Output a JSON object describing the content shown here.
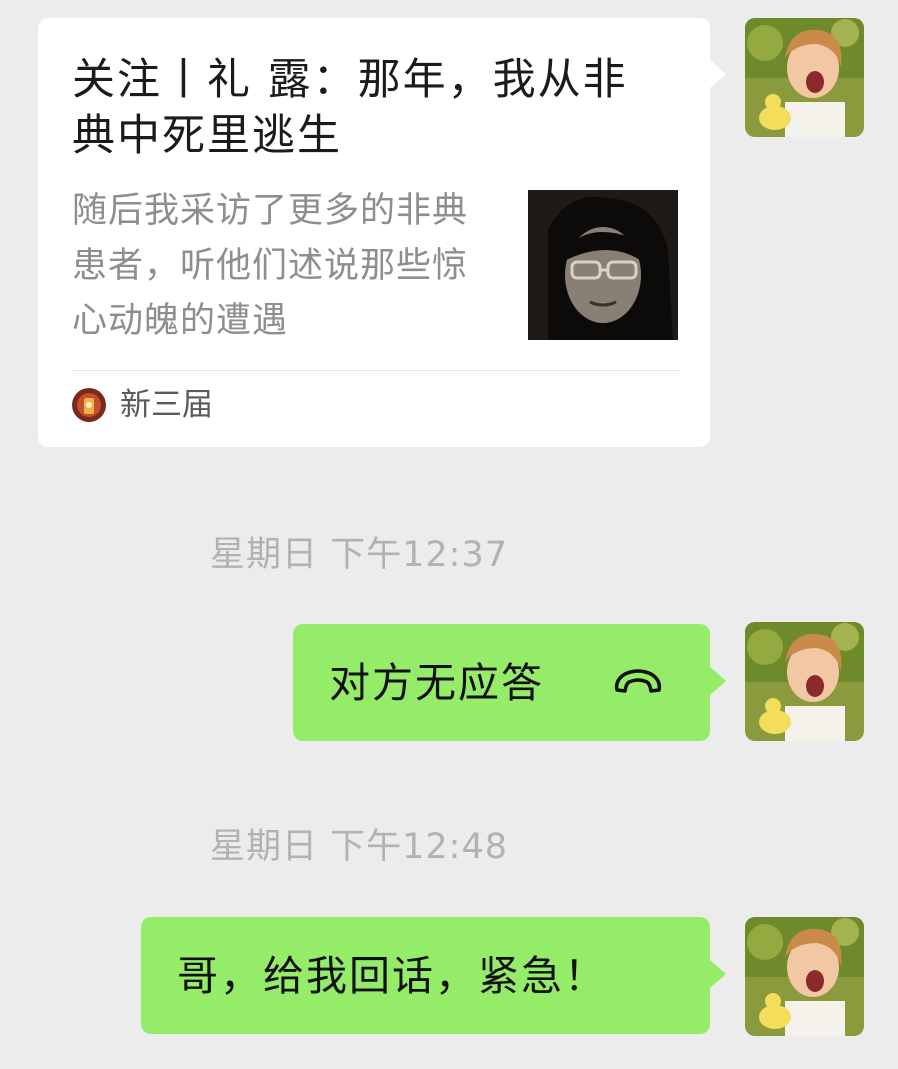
{
  "article_card": {
    "title": "关注丨礼 露：那年，我从非典中死里逃生",
    "description": "随后我采访了更多的非典患者，听他们述说那些惊心动魄的遭遇",
    "source_name": "新三届"
  },
  "messages": [
    {
      "timestamp": "星期日 下午12:37",
      "text": "对方无应答",
      "icon": "hangup-phone-icon"
    },
    {
      "timestamp": "星期日 下午12:48",
      "text": "哥，给我回话，紧急！"
    }
  ],
  "colors": {
    "background": "#ececec",
    "bubble_green": "#95ec69",
    "card_white": "#ffffff",
    "timestamp_gray": "#b2b2b2"
  }
}
